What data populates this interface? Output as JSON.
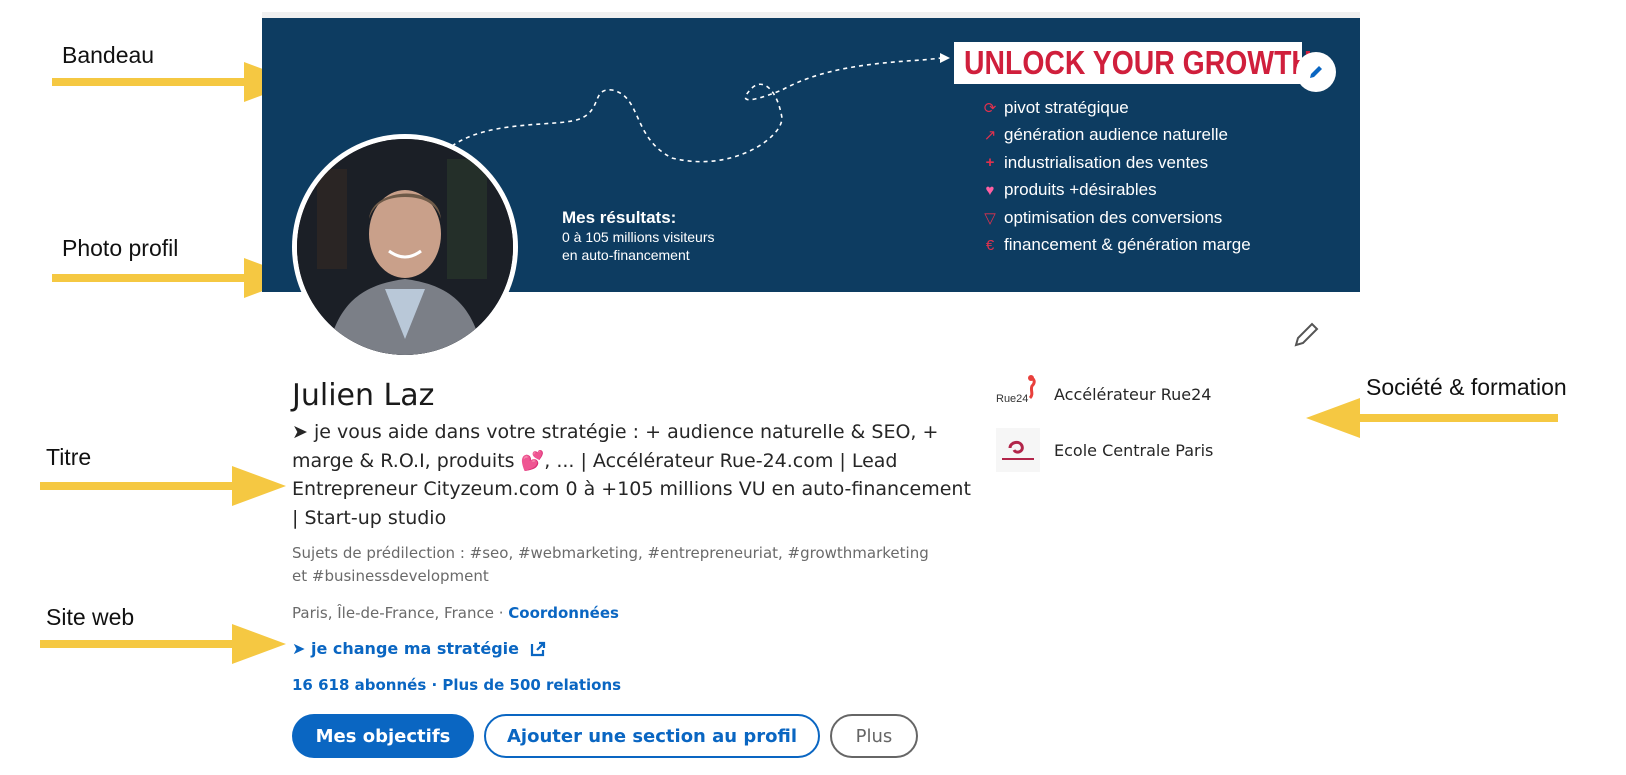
{
  "annotations": {
    "bandeau": "Bandeau",
    "photo_profil": "Photo profil",
    "titre": "Titre",
    "site_web": "Site web",
    "societe_formation": "Société & formation"
  },
  "banner": {
    "unlock_title": "UNLOCK YOUR GROWTH",
    "bullets": [
      {
        "icon": "cycle-icon",
        "text": "pivot stratégique"
      },
      {
        "icon": "trend-arrow-icon",
        "text": "génération audience naturelle"
      },
      {
        "icon": "plus-icon",
        "text": "industrialisation des ventes"
      },
      {
        "icon": "hearts-icon",
        "text": "produits +désirables"
      },
      {
        "icon": "funnel-icon",
        "text": "optimisation des conversions"
      },
      {
        "icon": "euro-icon",
        "text": "financement & génération marge"
      }
    ],
    "results_title": "Mes résultats:",
    "results_line1": "0 à 105 millions visiteurs",
    "results_line2": "en auto-financement"
  },
  "profile": {
    "name": "Julien Laz",
    "headline": "➤ je vous aide dans votre stratégie : + audience naturelle & SEO, + marge & R.O.I, produits 💕, ... | Accélérateur Rue-24.com | Lead Entrepreneur Cityzeum.com 0 à +105 millions VU en auto-financement | Start-up studio",
    "topics": "Sujets de prédilection : #seo, #webmarketing, #entrepreneuriat, #growthmarketing et #businessdevelopment",
    "location": "Paris, Île-de-France, France · ",
    "contact_link": "Coordonnées",
    "website": "➤ je change ma stratégie",
    "followers": "16 618 abonnés",
    "relations": " · Plus de 500 relations"
  },
  "buttons": {
    "primary": "Mes objectifs",
    "add_section": "Ajouter une section au profil",
    "more": "Plus"
  },
  "orgs": {
    "company": "Accélérateur Rue24",
    "company_logo_text": "Rue24",
    "school": "Ecole Centrale Paris"
  },
  "colors": {
    "banner_bg": "#0d3c61",
    "accent_red": "#d01f3c",
    "linkedin_blue": "#0a66c2",
    "annotation_arrow": "#f5c842"
  }
}
